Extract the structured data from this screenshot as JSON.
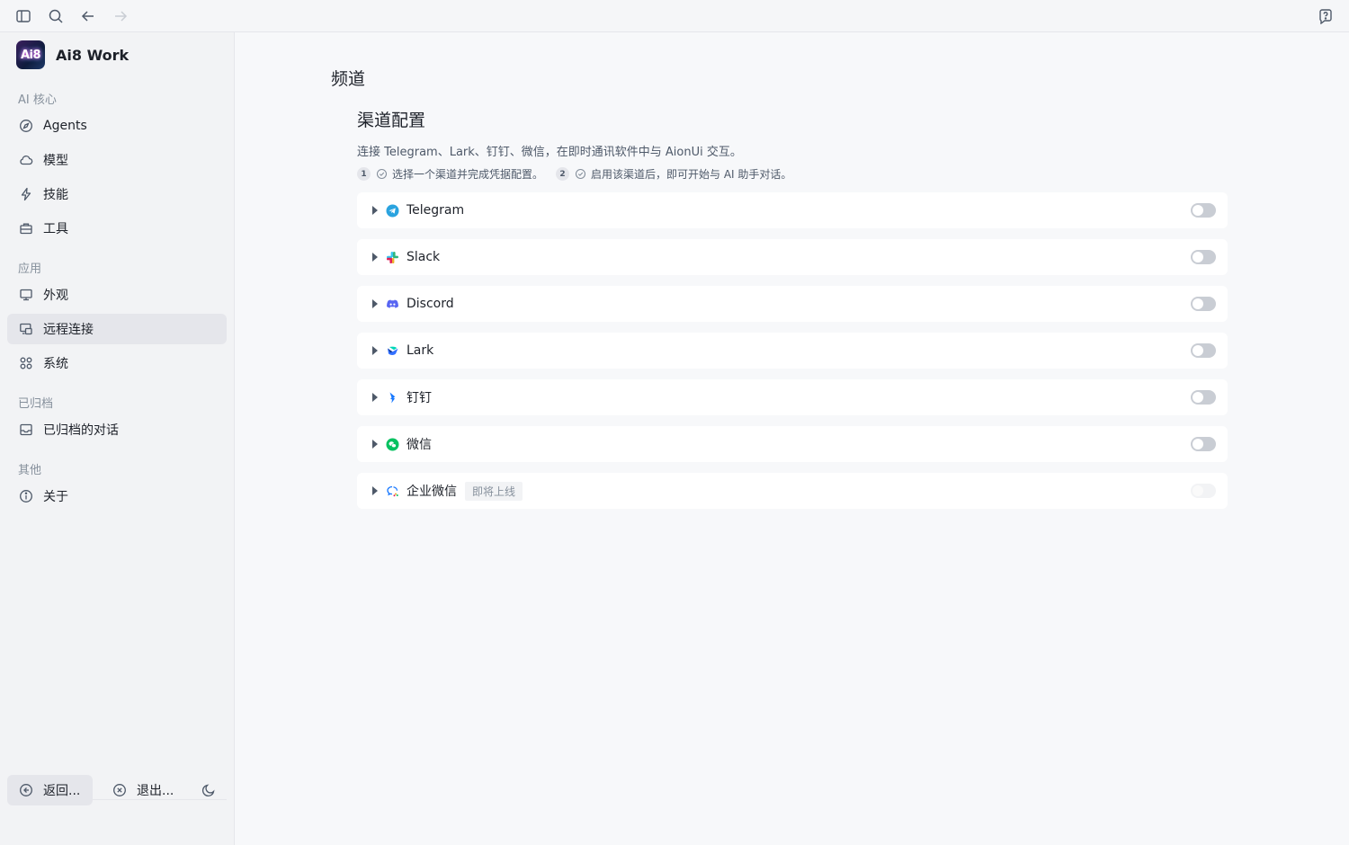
{
  "app": {
    "name": "Ai8 Work",
    "logo_text": "Ai8"
  },
  "topbar": {
    "icons": [
      "sidebar-toggle-icon",
      "search-icon",
      "back-arrow-icon",
      "forward-arrow-icon",
      "help-icon"
    ]
  },
  "sidebar": {
    "sections": [
      {
        "title": "AI 核心",
        "items": [
          {
            "label": "Agents",
            "icon": "compass-icon"
          },
          {
            "label": "模型",
            "icon": "cloud-icon"
          },
          {
            "label": "技能",
            "icon": "lightning-icon"
          },
          {
            "label": "工具",
            "icon": "toolbox-icon"
          }
        ]
      },
      {
        "title": "应用",
        "items": [
          {
            "label": "外观",
            "icon": "monitor-icon"
          },
          {
            "label": "远程连接",
            "icon": "remote-icon",
            "active": true
          },
          {
            "label": "系统",
            "icon": "grid-icon"
          }
        ]
      },
      {
        "title": "已归档",
        "items": [
          {
            "label": "已归档的对话",
            "icon": "archive-icon"
          }
        ]
      },
      {
        "title": "其他",
        "items": [
          {
            "label": "关于",
            "icon": "info-icon"
          }
        ]
      }
    ],
    "bottom": {
      "back_label": "返回...",
      "exit_label": "退出..."
    }
  },
  "main": {
    "page_title": "频道",
    "section_title": "渠道配置",
    "description": "连接 Telegram、Lark、钉钉、微信，在即时通讯软件中与 AionUi 交互。",
    "steps": [
      {
        "num": "1",
        "text": "选择一个渠道并完成凭据配置。"
      },
      {
        "num": "2",
        "text": "启用该渠道后，即可开始与 AI 助手对话。"
      }
    ],
    "channels": [
      {
        "name": "Telegram",
        "icon": "telegram-icon",
        "enabled": false
      },
      {
        "name": "Slack",
        "icon": "slack-icon",
        "enabled": false
      },
      {
        "name": "Discord",
        "icon": "discord-icon",
        "enabled": false
      },
      {
        "name": "Lark",
        "icon": "lark-icon",
        "enabled": false
      },
      {
        "name": "钉钉",
        "icon": "dingtalk-icon",
        "enabled": false
      },
      {
        "name": "微信",
        "icon": "wechat-icon",
        "enabled": false
      },
      {
        "name": "企业微信",
        "icon": "wecom-icon",
        "enabled": false,
        "badge": "即将上线",
        "disabled": true
      }
    ]
  },
  "colors": {
    "sidebar_bg": "#f2f3f5",
    "main_bg": "#f7f8fa",
    "active_item": "#e5e6eb",
    "toggle_off": "#c9cdd4",
    "telegram": "#2aa3df",
    "discord": "#5865f2",
    "wechat": "#07c160",
    "dingtalk": "#1677ff"
  }
}
